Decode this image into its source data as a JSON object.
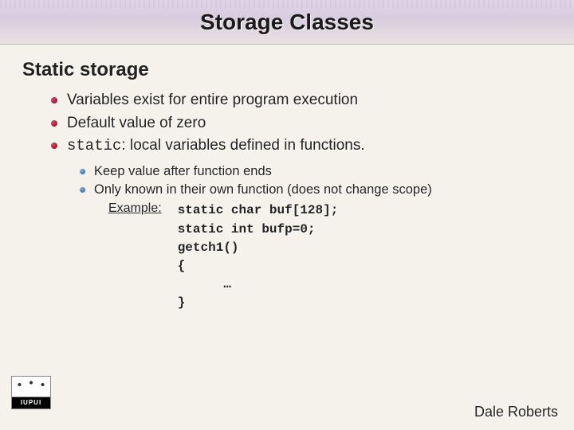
{
  "title": "Storage Classes",
  "section": "Static storage",
  "level1": {
    "a": "Variables exist for entire program execution",
    "b": "Default value of zero",
    "c_pre": "static",
    "c_post": ": local variables defined in functions."
  },
  "level2": {
    "a": "Keep value after function ends",
    "b": "Only known in their own function (does not change scope)"
  },
  "example_label": "Example:",
  "code": "static char buf[128];\nstatic int bufp=0;\ngetch1()\n{\n      …\n}",
  "logo_text": "IUPUI",
  "author": "Dale Roberts"
}
